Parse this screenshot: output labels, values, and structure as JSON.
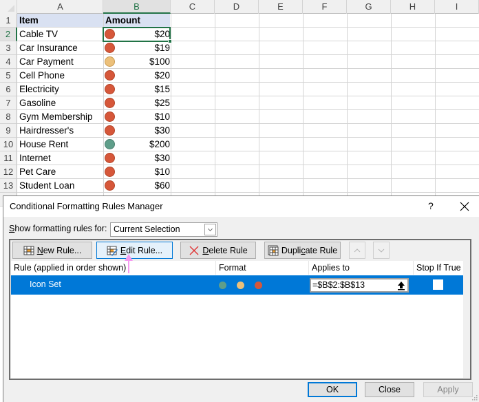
{
  "spreadsheet": {
    "columns": [
      "A",
      "B",
      "C",
      "D",
      "E",
      "F",
      "G",
      "H",
      "I"
    ],
    "active_column": "B",
    "active_row": 2,
    "header_row": {
      "row": 1,
      "item": "Item",
      "amount": "Amount"
    },
    "rows": [
      {
        "row": 2,
        "item": "Cable TV",
        "icon": "red-circle-icon",
        "amount": "$20"
      },
      {
        "row": 3,
        "item": "Car Insurance",
        "icon": "red-circle-icon",
        "amount": "$19"
      },
      {
        "row": 4,
        "item": "Car Payment",
        "icon": "yellow-circle-icon",
        "amount": "$100"
      },
      {
        "row": 5,
        "item": "Cell Phone",
        "icon": "red-circle-icon",
        "amount": "$20"
      },
      {
        "row": 6,
        "item": "Electricity",
        "icon": "red-circle-icon",
        "amount": "$15"
      },
      {
        "row": 7,
        "item": "Gasoline",
        "icon": "red-circle-icon",
        "amount": "$25"
      },
      {
        "row": 8,
        "item": "Gym Membership",
        "icon": "red-circle-icon",
        "amount": "$10"
      },
      {
        "row": 9,
        "item": "Hairdresser's",
        "icon": "red-circle-icon",
        "amount": "$30"
      },
      {
        "row": 10,
        "item": "House Rent",
        "icon": "green-circle-icon",
        "amount": "$200"
      },
      {
        "row": 11,
        "item": "Internet",
        "icon": "red-circle-icon",
        "amount": "$30"
      },
      {
        "row": 12,
        "item": "Pet Care",
        "icon": "red-circle-icon",
        "amount": "$10"
      },
      {
        "row": 13,
        "item": "Student Loan",
        "icon": "red-circle-icon",
        "amount": "$60"
      }
    ],
    "icon_colors": {
      "red": "#d6573a",
      "yellow": "#ecc07a",
      "green": "#5f9e8a"
    },
    "header_fill": "#d9e1f2",
    "selection_color": "#217346"
  },
  "dialog": {
    "title": "Conditional Formatting Rules Manager",
    "help_label": "?",
    "show_rules_label_pre": "",
    "show_rules_label_u": "S",
    "show_rules_label_post": "how formatting rules for:",
    "scope_value": "Current Selection",
    "toolbar": {
      "new_rule_u": "N",
      "new_rule_rest": "ew Rule...",
      "edit_rule_u": "E",
      "edit_rule_rest": "dit Rule...",
      "delete_rule_u": "D",
      "delete_rule_rest": "elete Rule",
      "duplicate_rule_pre": "Dupli",
      "duplicate_rule_u": "c",
      "duplicate_rule_post": "ate Rule"
    },
    "table": {
      "headers": {
        "rule": "Rule (applied in order shown)",
        "format": "Format",
        "applies_to": "Applies to",
        "stop_if_true": "Stop If True"
      },
      "rows": [
        {
          "rule": "Icon Set",
          "format_icons": [
            "green-circle-icon",
            "yellow-circle-icon",
            "red-circle-icon"
          ],
          "applies_to": "=$B$2:$B$13",
          "stop_if_true": false
        }
      ]
    },
    "footer": {
      "ok": "OK",
      "close": "Close",
      "apply": "Apply"
    },
    "accent_color": "#0078d7"
  }
}
